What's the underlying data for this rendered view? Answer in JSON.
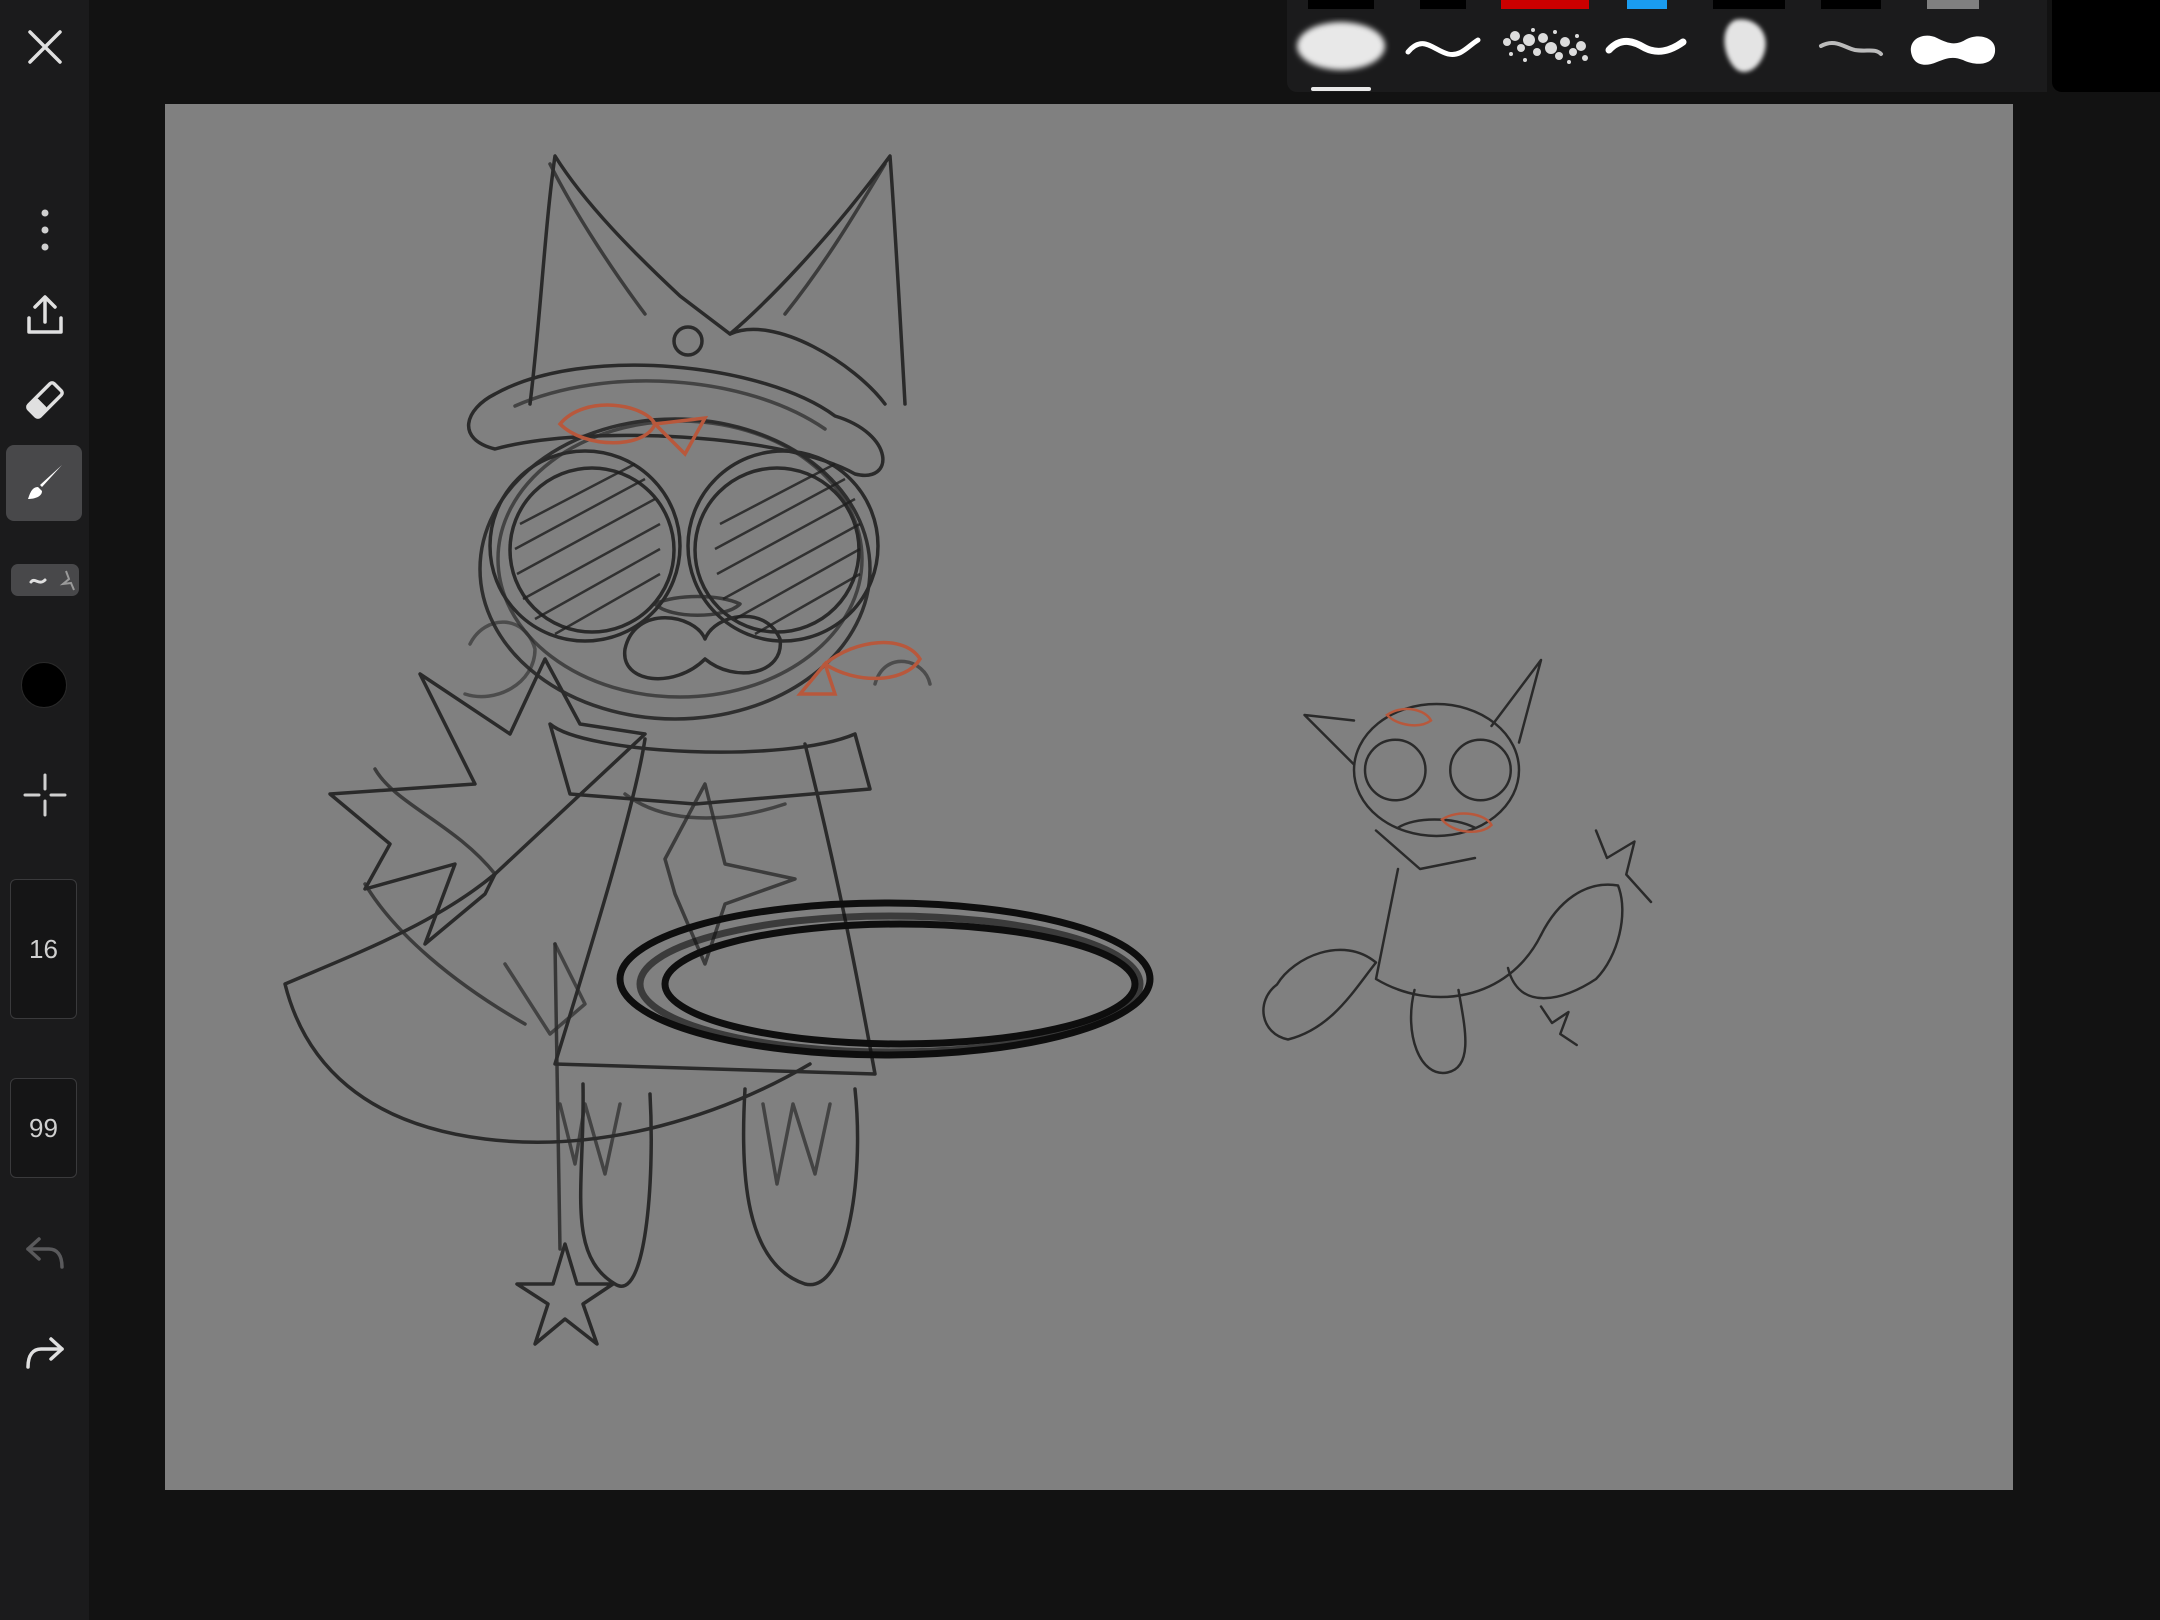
{
  "toolbar": {
    "close_icon": "close-icon",
    "more_icon": "more-vertical-icon",
    "export_icon": "upload-icon",
    "eraser_icon": "eraser-icon",
    "brush_icon": "brush-icon",
    "active_tool": "brush",
    "brush_selector_icon": "brush-preset-icon",
    "current_color": "#000000",
    "symmetry_icon": "crosshair-icon",
    "brush_size": "16",
    "opacity": "99",
    "undo_icon": "undo-icon",
    "redo_icon": "redo-icon"
  },
  "brush_presets": [
    {
      "name": "soft-airbrush",
      "accent": "#000000",
      "selected": true
    },
    {
      "name": "ink-pen",
      "accent": "#000000",
      "selected": false
    },
    {
      "name": "splatter",
      "accent": "#cc0000",
      "selected": false
    },
    {
      "name": "marker",
      "accent": "#1a9cf0",
      "selected": false
    },
    {
      "name": "chalk",
      "accent": "#000000",
      "selected": false
    },
    {
      "name": "fine-liner",
      "accent": "#000000",
      "selected": false
    },
    {
      "name": "blob-brush",
      "accent": "#808080",
      "selected": false
    }
  ],
  "canvas": {
    "background": "#808080",
    "artwork": "cat-character-sketch"
  }
}
